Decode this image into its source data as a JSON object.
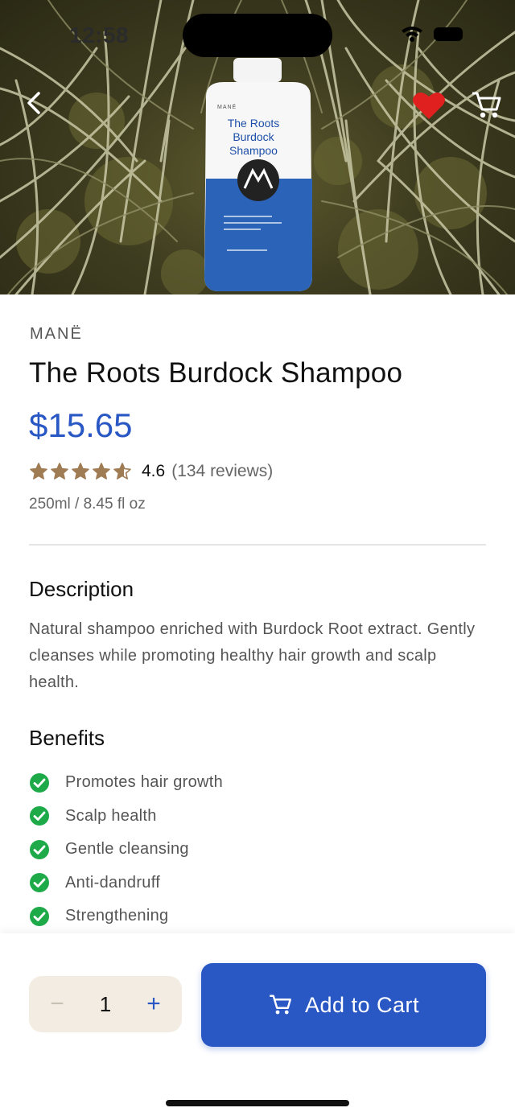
{
  "status_bar": {
    "time": "12:58"
  },
  "product": {
    "brand": "MANË",
    "title": "The Roots Burdock Shampoo",
    "price": "$15.65",
    "rating": 4.6,
    "rating_text": "4.6",
    "reviews_text": "(134 reviews)",
    "size": "250ml / 8.45 fl oz",
    "favorite": true
  },
  "bottle_label": {
    "brand": "MANË",
    "line1": "The Roots",
    "line2": "Burdock",
    "line3": "Shampoo"
  },
  "description": {
    "heading": "Description",
    "text": "Natural shampoo enriched with Burdock Root extract. Gently cleanses while promoting healthy hair growth and scalp health."
  },
  "benefits": {
    "heading": "Benefits",
    "items": [
      "Promotes hair growth",
      "Scalp health",
      "Gentle cleansing",
      "Anti-dandruff",
      "Strengthening"
    ]
  },
  "cart_bar": {
    "quantity": "1",
    "minus": "−",
    "plus": "+",
    "add_label": "Add to Cart"
  },
  "icons": {
    "back": "chevron-left-icon",
    "favorite": "heart-icon",
    "cart": "cart-icon",
    "benefit": "check-circle-icon"
  },
  "colors": {
    "accent": "#2957c4",
    "heart": "#e0201e",
    "star": "#a07c55",
    "check": "#1faa4a",
    "qty_bg": "#f3ece2"
  }
}
